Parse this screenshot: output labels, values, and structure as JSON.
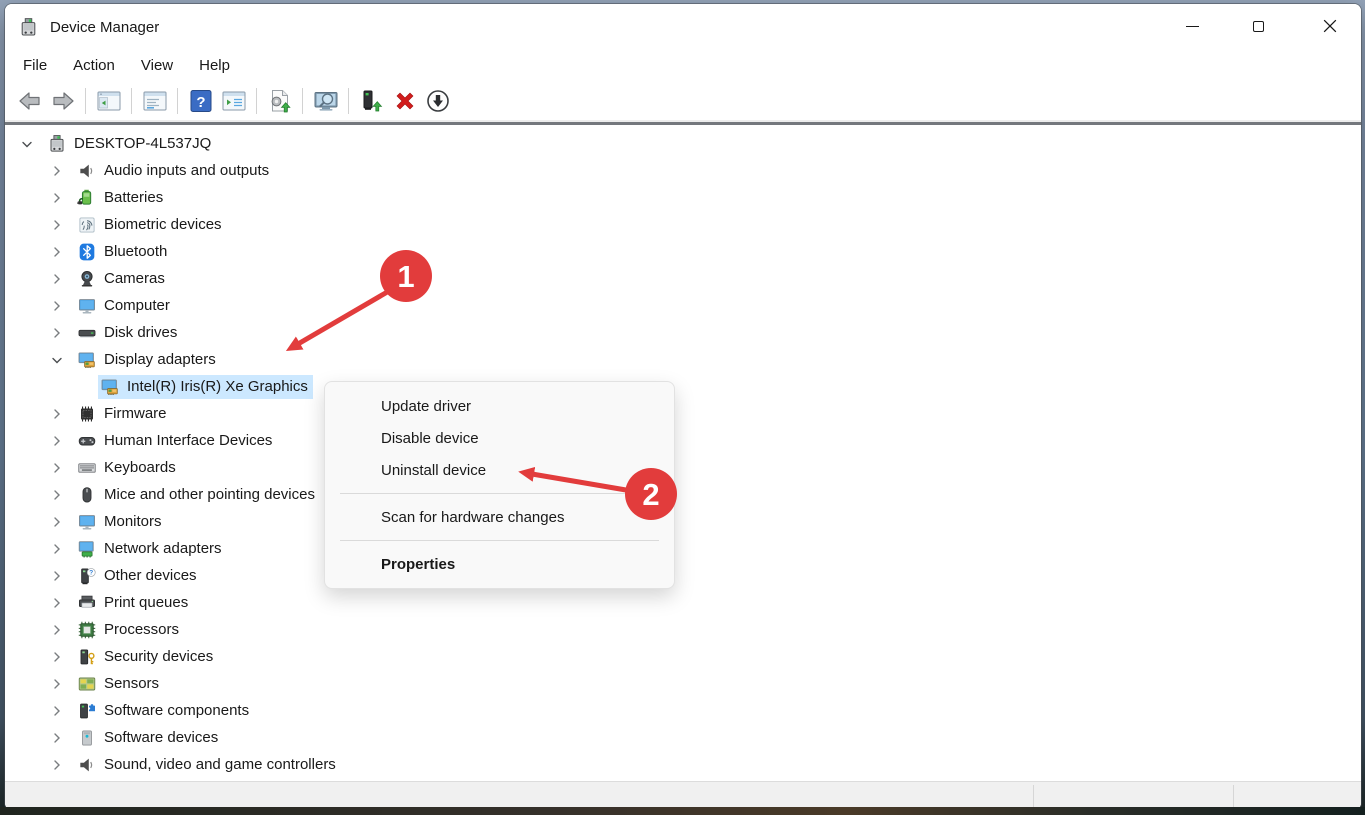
{
  "window": {
    "title": "Device Manager",
    "app_icon": "computer-device"
  },
  "menubar": {
    "items": [
      {
        "label": "File"
      },
      {
        "label": "Action"
      },
      {
        "label": "View"
      },
      {
        "label": "Help"
      }
    ]
  },
  "toolbar": {
    "buttons": [
      {
        "name": "back",
        "icon": "back-arrow"
      },
      {
        "name": "forward",
        "icon": "forward-arrow"
      },
      {
        "sep": true
      },
      {
        "name": "show-console-tree",
        "icon": "console-window"
      },
      {
        "sep": true
      },
      {
        "name": "properties",
        "icon": "properties-window"
      },
      {
        "sep": true
      },
      {
        "name": "help",
        "icon": "help"
      },
      {
        "name": "action-pane",
        "icon": "list-window"
      },
      {
        "sep": true
      },
      {
        "name": "update-driver",
        "icon": "page-up-arrow"
      },
      {
        "sep": true
      },
      {
        "name": "scan-hardware-changes",
        "icon": "scan-monitor"
      },
      {
        "sep": true
      },
      {
        "name": "update-device-driver",
        "icon": "device-up-arrow"
      },
      {
        "name": "uninstall-device",
        "icon": "red-x"
      },
      {
        "name": "disable-device",
        "icon": "down-arrow-circle"
      }
    ]
  },
  "tree": {
    "items": [
      {
        "label": "DESKTOP-4L537JQ",
        "level": 0,
        "chevron": "down",
        "icon": "computer-device",
        "selected": false
      },
      {
        "label": "Audio inputs and outputs",
        "level": 1,
        "chevron": "right",
        "icon": "speaker",
        "selected": false
      },
      {
        "label": "Batteries",
        "level": 1,
        "chevron": "right",
        "icon": "battery",
        "selected": false
      },
      {
        "label": "Biometric devices",
        "level": 1,
        "chevron": "right",
        "icon": "fingerprint",
        "selected": false
      },
      {
        "label": "Bluetooth",
        "level": 1,
        "chevron": "right",
        "icon": "bluetooth",
        "selected": false
      },
      {
        "label": "Cameras",
        "level": 1,
        "chevron": "right",
        "icon": "camera",
        "selected": false
      },
      {
        "label": "Computer",
        "level": 1,
        "chevron": "right",
        "icon": "monitor",
        "selected": false
      },
      {
        "label": "Disk drives",
        "level": 1,
        "chevron": "right",
        "icon": "disk",
        "selected": false
      },
      {
        "label": "Display adapters",
        "level": 1,
        "chevron": "down",
        "icon": "display-adapter",
        "selected": false
      },
      {
        "label": "Intel(R) Iris(R) Xe Graphics",
        "level": 2,
        "chevron": "none",
        "icon": "display-adapter",
        "selected": true
      },
      {
        "label": "Firmware",
        "level": 1,
        "chevron": "right",
        "icon": "firmware",
        "selected": false
      },
      {
        "label": "Human Interface Devices",
        "level": 1,
        "chevron": "right",
        "icon": "hid",
        "selected": false
      },
      {
        "label": "Keyboards",
        "level": 1,
        "chevron": "right",
        "icon": "keyboard",
        "selected": false
      },
      {
        "label": "Mice and other pointing devices",
        "level": 1,
        "chevron": "right",
        "icon": "mouse",
        "selected": false
      },
      {
        "label": "Monitors",
        "level": 1,
        "chevron": "right",
        "icon": "monitor",
        "selected": false
      },
      {
        "label": "Network adapters",
        "level": 1,
        "chevron": "right",
        "icon": "network",
        "selected": false
      },
      {
        "label": "Other devices",
        "level": 1,
        "chevron": "right",
        "icon": "unknown-device",
        "selected": false
      },
      {
        "label": "Print queues",
        "level": 1,
        "chevron": "right",
        "icon": "printer",
        "selected": false
      },
      {
        "label": "Processors",
        "level": 1,
        "chevron": "right",
        "icon": "processor",
        "selected": false
      },
      {
        "label": "Security devices",
        "level": 1,
        "chevron": "right",
        "icon": "security-device",
        "selected": false
      },
      {
        "label": "Sensors",
        "level": 1,
        "chevron": "right",
        "icon": "sensor",
        "selected": false
      },
      {
        "label": "Software components",
        "level": 1,
        "chevron": "right",
        "icon": "software-component",
        "selected": false
      },
      {
        "label": "Software devices",
        "level": 1,
        "chevron": "right",
        "icon": "software-device",
        "selected": false
      },
      {
        "label": "Sound, video and game controllers",
        "level": 1,
        "chevron": "right",
        "icon": "speaker",
        "selected": false
      }
    ]
  },
  "context_menu": {
    "items": [
      {
        "label": "Update driver",
        "name": "update-driver"
      },
      {
        "label": "Disable device",
        "name": "disable-device"
      },
      {
        "label": "Uninstall device",
        "name": "uninstall-device"
      },
      {
        "sep": true
      },
      {
        "label": "Scan for hardware changes",
        "name": "scan-for-hardware-changes"
      },
      {
        "sep": true
      },
      {
        "label": "Properties",
        "name": "properties",
        "bold": true
      }
    ]
  },
  "annotations": {
    "color": "#e23c3c",
    "step1": "1",
    "step2": "2"
  }
}
